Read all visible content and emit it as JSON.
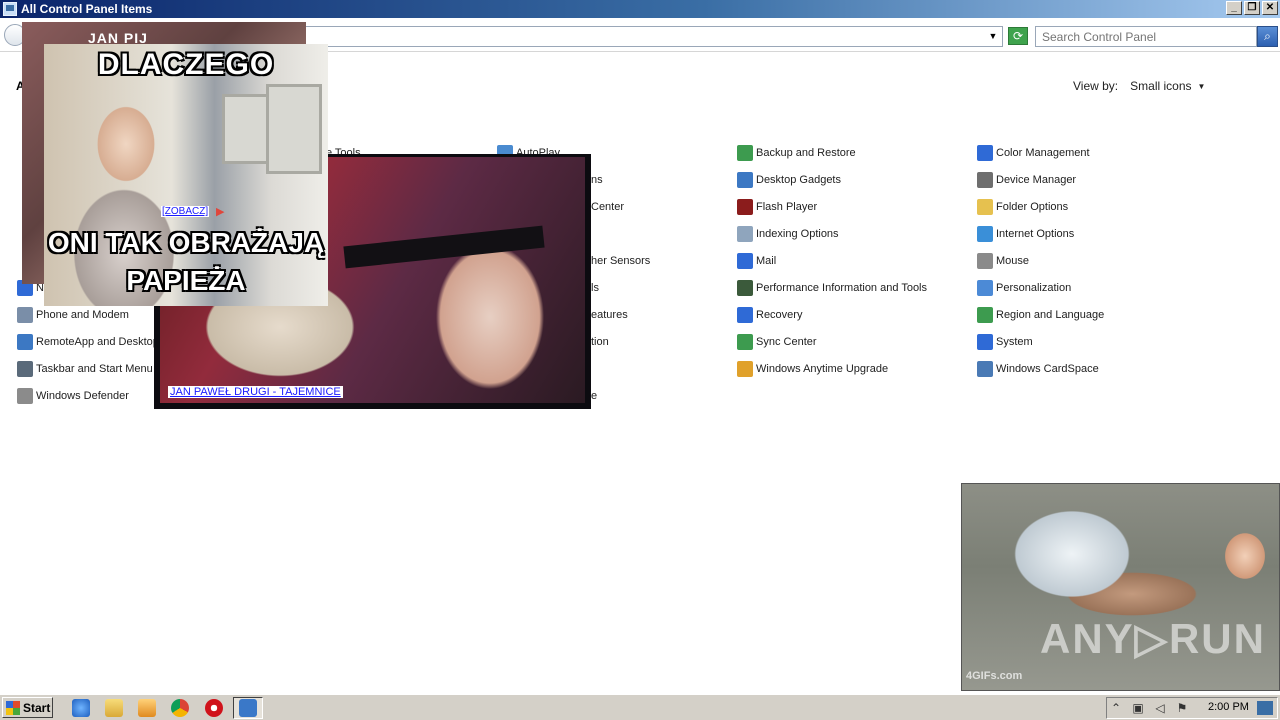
{
  "window": {
    "title": "All Control Panel Items"
  },
  "toolbar": {
    "search_placeholder": "Search Control Panel"
  },
  "content": {
    "heading": "A",
    "view_by_label": "View by:",
    "view_by_value": "Small icons"
  },
  "items": [
    {
      "label": "Phone and Modem",
      "color": "#7a8ea8"
    },
    {
      "label": "RemoteApp and Desktop",
      "color": "#3c78c3"
    },
    {
      "label": "Taskbar and Start Menu",
      "color": "#5a6a7a"
    },
    {
      "label": "Windows Defender",
      "color": "#8b8b8b"
    },
    {
      "label": "Ne",
      "color": "#2f6ad6"
    },
    {
      "label": "ive Tools",
      "color": "#7a7a7a"
    },
    {
      "label": "AutoPlay",
      "color": "#4a8bd0"
    },
    {
      "label": "ns",
      "color": "#bbbbbb"
    },
    {
      "label": "Center",
      "color": "#bbbbbb"
    },
    {
      "label": "her Sensors",
      "color": "#bbbbbb"
    },
    {
      "label": "ls",
      "color": "#bbbbbb"
    },
    {
      "label": "eatures",
      "color": "#bbbbbb"
    },
    {
      "label": "tion",
      "color": "#bbbbbb"
    },
    {
      "label": "e",
      "color": "#bbbbbb"
    },
    {
      "label": "Backup and Restore",
      "color": "#3d9b4f"
    },
    {
      "label": "Desktop Gadgets",
      "color": "#3c78c3"
    },
    {
      "label": "Flash Player",
      "color": "#8b1c1c"
    },
    {
      "label": "Indexing Options",
      "color": "#8fa5bd"
    },
    {
      "label": "Mail",
      "color": "#2f6ad6"
    },
    {
      "label": "Performance Information and Tools",
      "color": "#3b5a3b"
    },
    {
      "label": "Recovery",
      "color": "#2f6ad6"
    },
    {
      "label": "Sync Center",
      "color": "#3d9b4f"
    },
    {
      "label": "Windows Anytime Upgrade",
      "color": "#e0a12b"
    },
    {
      "label": "Color Management",
      "color": "#2f6ad6"
    },
    {
      "label": "Device Manager",
      "color": "#6e6e6e"
    },
    {
      "label": "Folder Options",
      "color": "#e6c14f"
    },
    {
      "label": "Internet Options",
      "color": "#3a8fd8"
    },
    {
      "label": "Mouse",
      "color": "#8a8a8a"
    },
    {
      "label": "Personalization",
      "color": "#4c8ad6"
    },
    {
      "label": "Region and Language",
      "color": "#3d9b4f"
    },
    {
      "label": "System",
      "color": "#2f6ad6"
    },
    {
      "label": "Windows CardSpace",
      "color": "#4a7ab5"
    }
  ],
  "ads": {
    "back_title": "JAN PIJ",
    "front_top": "DLACZEGO",
    "front_bottom": "ONI TAK OBRAŻAJĄ PAPIEŻA",
    "zobacz": "[ZOBACZ]",
    "mid_link": "JAN PAWEŁ DRUGI - TAJEMNICE",
    "gif_watermark": "ANY▷RUN",
    "gif_source": "4GIFs.com"
  },
  "taskbar": {
    "start_label": "Start",
    "clock": "2:00 PM"
  }
}
